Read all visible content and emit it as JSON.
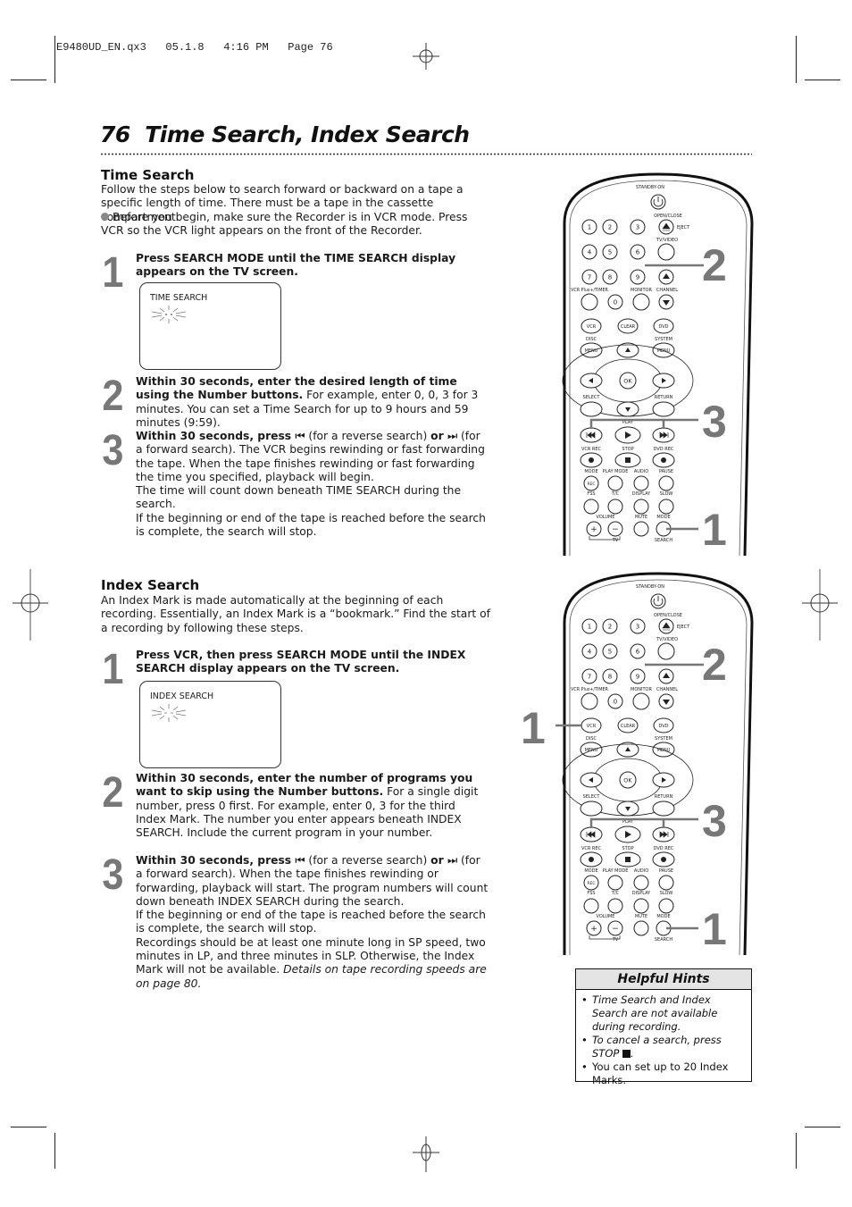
{
  "slug": "E9480UD_EN.qx3   05.1.8   4:16 PM   Page 76",
  "page": {
    "number": "76",
    "title": "Time Search, Index Search"
  },
  "time_search": {
    "heading": "Time Search",
    "intro": "Follow the steps below to search forward or backward on a tape a specific length of time. There must be a tape in the cassette compartment.",
    "bullet": "Before you begin, make sure the Recorder is in VCR mode. Press VCR so the VCR light appears on the front of the Recorder.",
    "steps": [
      {
        "num": "1",
        "bold": "Press SEARCH MODE until the TIME SEARCH display appears on the TV screen.",
        "text": ""
      },
      {
        "num": "2",
        "bold": "Within 30 seconds, enter the desired length of time using the Number buttons.",
        "text": " For example, enter 0, 0, 3 for 3 minutes. You can set a Time Search for up to 9 hours and 59 minutes (9:59)."
      },
      {
        "num": "3",
        "bold_a": "Within 30 seconds, press ",
        "rev_icon": "⏮",
        "mid": " (for a reverse search) ",
        "bold_b": "or ",
        "fwd_icon": "⏭",
        "text": " (for a forward search). The VCR begins rewinding or fast forwarding the tape. When the tape finishes rewinding or fast forwarding the time you specified, playback will begin.",
        "text2": "The time will count down beneath TIME SEARCH during the search.",
        "text3": "If the beginning or end of the tape is reached before the search is complete, the search will stop."
      }
    ],
    "tv_label": "TIME SEARCH"
  },
  "index_search": {
    "heading": "Index Search",
    "intro": "An Index Mark is made automatically at the beginning of each recording. Essentially, an Index Mark is a “bookmark.” Find the start of a recording by following these steps.",
    "steps": [
      {
        "num": "1",
        "bold": "Press VCR, then press SEARCH MODE until the INDEX SEARCH display appears on the TV screen.",
        "text": ""
      },
      {
        "num": "2",
        "bold": "Within 30 seconds, enter the number of programs you want to skip using the Number buttons.",
        "text": " For a single digit number, press 0 first. For example, enter 0, 3 for the third Index Mark. The number you enter appears beneath INDEX SEARCH. Include the current program in your number."
      },
      {
        "num": "3",
        "bold_a": "Within 30 seconds, press ",
        "rev_icon": "⏮",
        "mid": " (for a reverse search) ",
        "bold_b": "or ",
        "fwd_icon": "⏭",
        "text": " (for a forward search). When the tape finishes rewinding or forwarding, playback will start. The program numbers will count down beneath INDEX SEARCH during the search.",
        "text2": "If the beginning or end of the tape is reached before the search is complete, the search will stop.",
        "text3": "Recordings should be at least one minute long in SP speed, two minutes in LP, and three minutes in SLP. Otherwise, the Index Mark will not be available. ",
        "italic": "Details on tape recording speeds are on page 80."
      }
    ],
    "tv_label": "INDEX SEARCH"
  },
  "remote": {
    "labels": {
      "standby": "STANDBY-ON",
      "openclose": "OPEN/CLOSE",
      "eject": "EJECT",
      "tvvideo": "TV/VIDEO",
      "vcrplus": "VCR Plus+/TIMER",
      "monitor": "MONITOR",
      "channel": "CHANNEL",
      "vcr": "VCR",
      "clear": "CLEAR",
      "dvd": "DVD",
      "disc": "DISC",
      "system": "SYSTEM",
      "menu": "MENU",
      "ok": "OK",
      "select": "SELECT",
      "return": "RETURN",
      "play": "PLAY",
      "vcrrec": "VCR REC",
      "stop": "STOP",
      "dvdrec": "DVD REC",
      "mode": "MODE",
      "playmode": "PLAY MODE",
      "audio": "AUDIO",
      "pause": "PAUSE",
      "rec": "REC",
      "fss": "FSS",
      "tc": "T/C",
      "display": "DISPLAY",
      "slow": "SLOW",
      "volume": "VOLUME",
      "mute": "MUTE",
      "search": "SEARCH",
      "tv": "TV",
      "digits": [
        "1",
        "2",
        "3",
        "4",
        "5",
        "6",
        "7",
        "8",
        "9",
        "0"
      ]
    },
    "callouts_top": [
      "2",
      "3",
      "1"
    ],
    "callouts_bottom": [
      "2",
      "1",
      "3",
      "1"
    ]
  },
  "hints": {
    "title": "Helpful Hints",
    "items": [
      {
        "text": "Time Search and Index Search are not available during recording.",
        "italic": true
      },
      {
        "text": "To cancel a search, press STOP ",
        "italic": true,
        "stop_icon": true
      },
      {
        "text": "You can set up to 20 Index Marks.",
        "italic": false
      }
    ]
  }
}
